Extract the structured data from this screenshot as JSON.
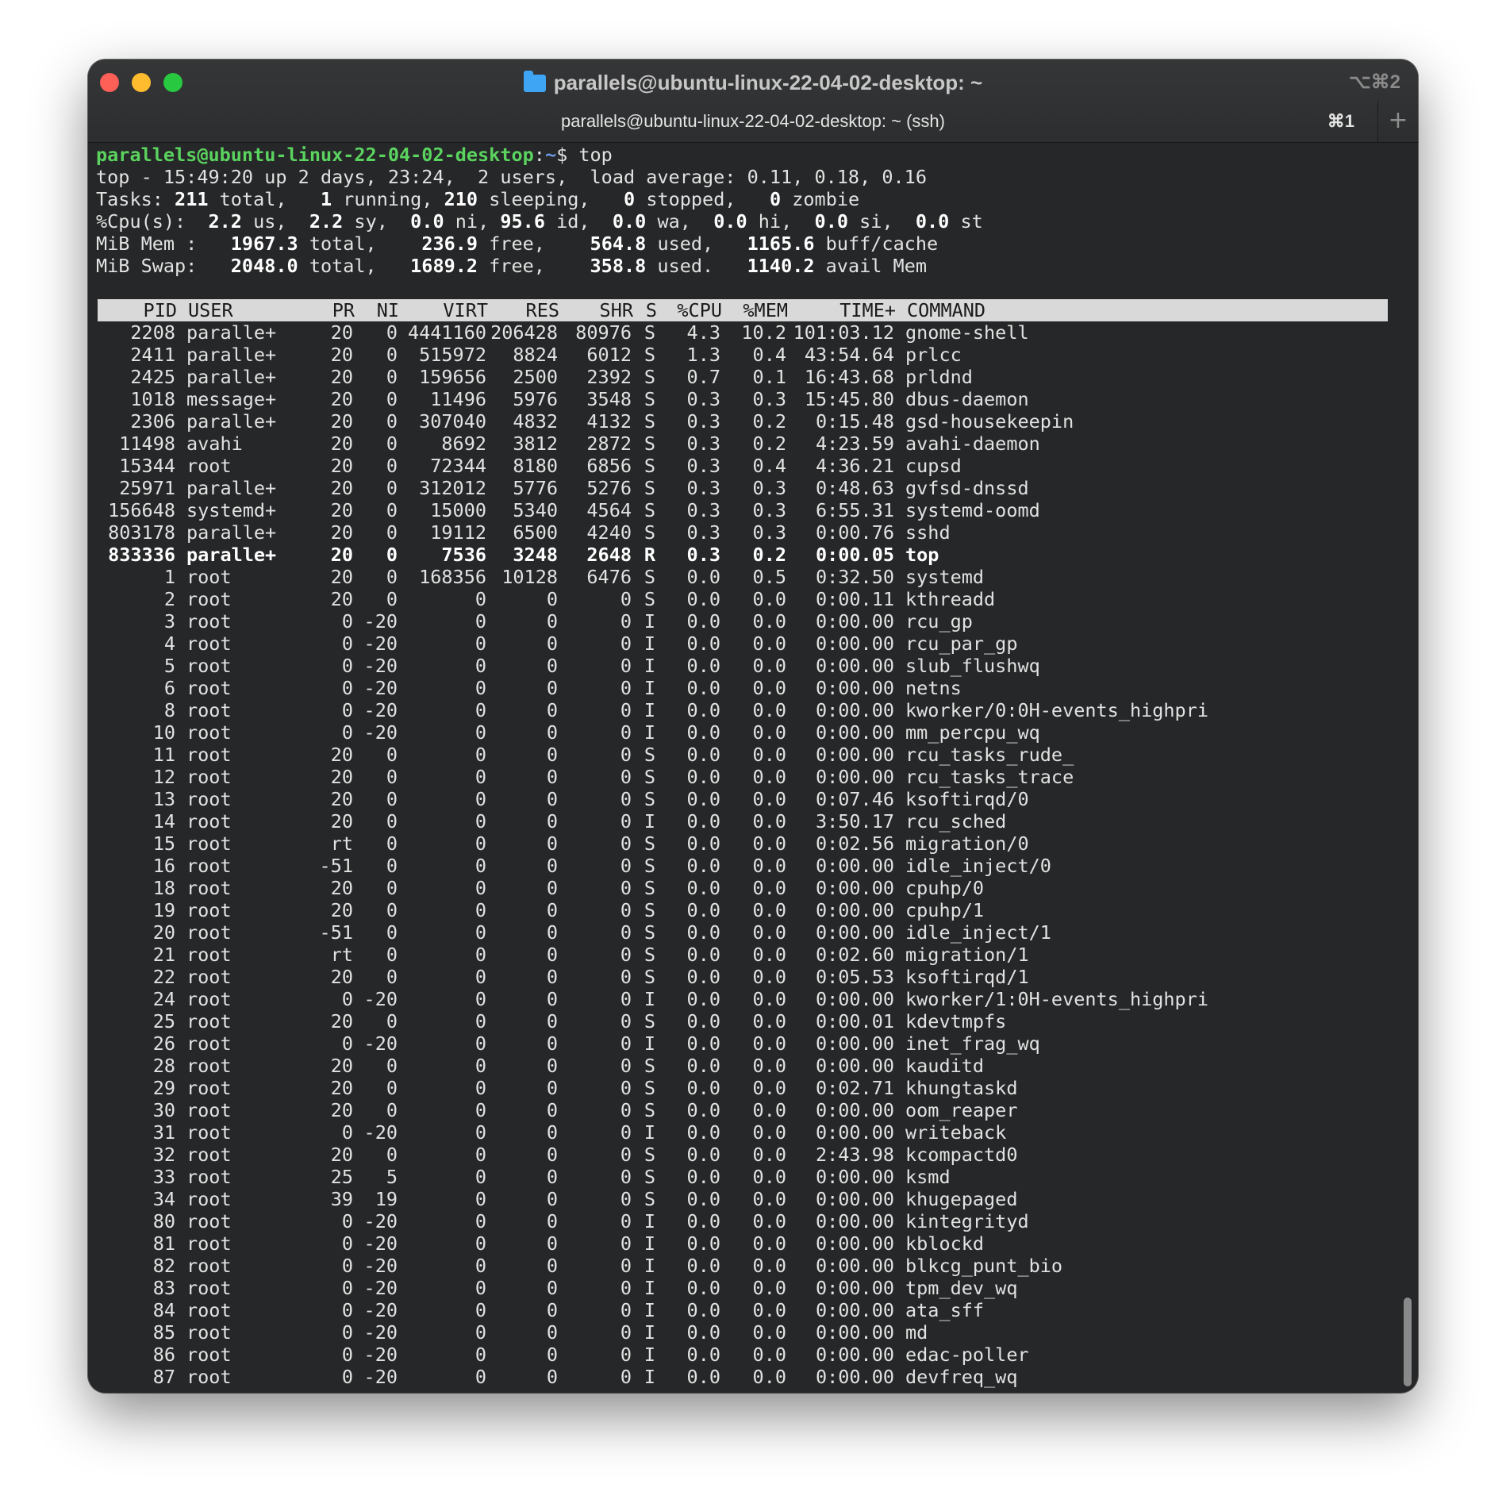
{
  "window": {
    "title": "parallels@ubuntu-linux-22-04-02-desktop: ~",
    "shortcut": "⌥⌘2",
    "icon": "folder-icon"
  },
  "tab": {
    "title": "parallels@ubuntu-linux-22-04-02-desktop: ~ (ssh)",
    "shortcut": "⌘1",
    "new_tab_symbol": "+"
  },
  "colors": {
    "prompt_user": "#5bd35f",
    "prompt_path": "#6f98e6",
    "header_bg": "#d9d9d9",
    "background": "#262728"
  },
  "prompt": {
    "user_host": "parallels@ubuntu-linux-22-04-02-desktop",
    "colon": ":",
    "path": "~",
    "symbol": "$ ",
    "command": "top"
  },
  "summary": {
    "line1": "top - 15:49:20 up 2 days, 23:24,  2 users,  load average: 0.11, 0.18, 0.16",
    "tasks": {
      "label": "Tasks: ",
      "total": "211",
      "total_label": " total,   ",
      "running": "1",
      "running_label": " running, ",
      "sleeping": "210",
      "sleeping_label": " sleeping,   ",
      "stopped": "0",
      "stopped_label": " stopped,   ",
      "zombie": "0",
      "zombie_label": " zombie"
    },
    "cpu": {
      "label": "%Cpu(s):  ",
      "us": "2.2",
      "us_label": " us,  ",
      "sy": "2.2",
      "sy_label": " sy,  ",
      "ni": "0.0",
      "ni_label": " ni, ",
      "id": "95.6",
      "id_label": " id,  ",
      "wa": "0.0",
      "wa_label": " wa,  ",
      "hi": "0.0",
      "hi_label": " hi,  ",
      "si": "0.0",
      "si_label": " si,  ",
      "st": "0.0",
      "st_label": " st"
    },
    "mem": {
      "label": "MiB Mem :   ",
      "total": "1967.3",
      "total_label": " total,    ",
      "free": "236.9",
      "free_label": " free,    ",
      "used": "564.8",
      "used_label": " used,   ",
      "buff": "1165.6",
      "buff_label": " buff/cache"
    },
    "swap": {
      "label": "MiB Swap:   ",
      "total": "2048.0",
      "total_label": " total,   ",
      "free": "1689.2",
      "free_label": " free,    ",
      "used": "358.8",
      "used_label": " used.   ",
      "avail": "1140.2",
      "avail_label": " avail Mem"
    }
  },
  "table": {
    "headers": [
      "PID",
      "USER",
      "PR",
      "NI",
      "VIRT",
      "RES",
      "SHR",
      "S",
      "%CPU",
      "%MEM",
      "TIME+",
      "COMMAND"
    ],
    "rows": [
      [
        "2208",
        "paralle+",
        "20",
        "0",
        "4441160",
        "206428",
        "80976",
        "S",
        "4.3",
        "10.2",
        "101:03.12",
        "gnome-shell"
      ],
      [
        "2411",
        "paralle+",
        "20",
        "0",
        "515972",
        "8824",
        "6012",
        "S",
        "1.3",
        "0.4",
        "43:54.64",
        "prlcc"
      ],
      [
        "2425",
        "paralle+",
        "20",
        "0",
        "159656",
        "2500",
        "2392",
        "S",
        "0.7",
        "0.1",
        "16:43.68",
        "prldnd"
      ],
      [
        "1018",
        "message+",
        "20",
        "0",
        "11496",
        "5976",
        "3548",
        "S",
        "0.3",
        "0.3",
        "15:45.80",
        "dbus-daemon"
      ],
      [
        "2306",
        "paralle+",
        "20",
        "0",
        "307040",
        "4832",
        "4132",
        "S",
        "0.3",
        "0.2",
        "0:15.48",
        "gsd-housekeepin"
      ],
      [
        "11498",
        "avahi",
        "20",
        "0",
        "8692",
        "3812",
        "2872",
        "S",
        "0.3",
        "0.2",
        "4:23.59",
        "avahi-daemon"
      ],
      [
        "15344",
        "root",
        "20",
        "0",
        "72344",
        "8180",
        "6856",
        "S",
        "0.3",
        "0.4",
        "4:36.21",
        "cupsd"
      ],
      [
        "25971",
        "paralle+",
        "20",
        "0",
        "312012",
        "5776",
        "5276",
        "S",
        "0.3",
        "0.3",
        "0:48.63",
        "gvfsd-dnssd"
      ],
      [
        "156648",
        "systemd+",
        "20",
        "0",
        "15000",
        "5340",
        "4564",
        "S",
        "0.3",
        "0.3",
        "6:55.31",
        "systemd-oomd"
      ],
      [
        "803178",
        "paralle+",
        "20",
        "0",
        "19112",
        "6500",
        "4240",
        "S",
        "0.3",
        "0.3",
        "0:00.76",
        "sshd"
      ],
      [
        "833336",
        "paralle+",
        "20",
        "0",
        "7536",
        "3248",
        "2648",
        "R",
        "0.3",
        "0.2",
        "0:00.05",
        "top"
      ],
      [
        "1",
        "root",
        "20",
        "0",
        "168356",
        "10128",
        "6476",
        "S",
        "0.0",
        "0.5",
        "0:32.50",
        "systemd"
      ],
      [
        "2",
        "root",
        "20",
        "0",
        "0",
        "0",
        "0",
        "S",
        "0.0",
        "0.0",
        "0:00.11",
        "kthreadd"
      ],
      [
        "3",
        "root",
        "0",
        "-20",
        "0",
        "0",
        "0",
        "I",
        "0.0",
        "0.0",
        "0:00.00",
        "rcu_gp"
      ],
      [
        "4",
        "root",
        "0",
        "-20",
        "0",
        "0",
        "0",
        "I",
        "0.0",
        "0.0",
        "0:00.00",
        "rcu_par_gp"
      ],
      [
        "5",
        "root",
        "0",
        "-20",
        "0",
        "0",
        "0",
        "I",
        "0.0",
        "0.0",
        "0:00.00",
        "slub_flushwq"
      ],
      [
        "6",
        "root",
        "0",
        "-20",
        "0",
        "0",
        "0",
        "I",
        "0.0",
        "0.0",
        "0:00.00",
        "netns"
      ],
      [
        "8",
        "root",
        "0",
        "-20",
        "0",
        "0",
        "0",
        "I",
        "0.0",
        "0.0",
        "0:00.00",
        "kworker/0:0H-events_highpri"
      ],
      [
        "10",
        "root",
        "0",
        "-20",
        "0",
        "0",
        "0",
        "I",
        "0.0",
        "0.0",
        "0:00.00",
        "mm_percpu_wq"
      ],
      [
        "11",
        "root",
        "20",
        "0",
        "0",
        "0",
        "0",
        "S",
        "0.0",
        "0.0",
        "0:00.00",
        "rcu_tasks_rude_"
      ],
      [
        "12",
        "root",
        "20",
        "0",
        "0",
        "0",
        "0",
        "S",
        "0.0",
        "0.0",
        "0:00.00",
        "rcu_tasks_trace"
      ],
      [
        "13",
        "root",
        "20",
        "0",
        "0",
        "0",
        "0",
        "S",
        "0.0",
        "0.0",
        "0:07.46",
        "ksoftirqd/0"
      ],
      [
        "14",
        "root",
        "20",
        "0",
        "0",
        "0",
        "0",
        "I",
        "0.0",
        "0.0",
        "3:50.17",
        "rcu_sched"
      ],
      [
        "15",
        "root",
        "rt",
        "0",
        "0",
        "0",
        "0",
        "S",
        "0.0",
        "0.0",
        "0:02.56",
        "migration/0"
      ],
      [
        "16",
        "root",
        "-51",
        "0",
        "0",
        "0",
        "0",
        "S",
        "0.0",
        "0.0",
        "0:00.00",
        "idle_inject/0"
      ],
      [
        "18",
        "root",
        "20",
        "0",
        "0",
        "0",
        "0",
        "S",
        "0.0",
        "0.0",
        "0:00.00",
        "cpuhp/0"
      ],
      [
        "19",
        "root",
        "20",
        "0",
        "0",
        "0",
        "0",
        "S",
        "0.0",
        "0.0",
        "0:00.00",
        "cpuhp/1"
      ],
      [
        "20",
        "root",
        "-51",
        "0",
        "0",
        "0",
        "0",
        "S",
        "0.0",
        "0.0",
        "0:00.00",
        "idle_inject/1"
      ],
      [
        "21",
        "root",
        "rt",
        "0",
        "0",
        "0",
        "0",
        "S",
        "0.0",
        "0.0",
        "0:02.60",
        "migration/1"
      ],
      [
        "22",
        "root",
        "20",
        "0",
        "0",
        "0",
        "0",
        "S",
        "0.0",
        "0.0",
        "0:05.53",
        "ksoftirqd/1"
      ],
      [
        "24",
        "root",
        "0",
        "-20",
        "0",
        "0",
        "0",
        "I",
        "0.0",
        "0.0",
        "0:00.00",
        "kworker/1:0H-events_highpri"
      ],
      [
        "25",
        "root",
        "20",
        "0",
        "0",
        "0",
        "0",
        "S",
        "0.0",
        "0.0",
        "0:00.01",
        "kdevtmpfs"
      ],
      [
        "26",
        "root",
        "0",
        "-20",
        "0",
        "0",
        "0",
        "I",
        "0.0",
        "0.0",
        "0:00.00",
        "inet_frag_wq"
      ],
      [
        "28",
        "root",
        "20",
        "0",
        "0",
        "0",
        "0",
        "S",
        "0.0",
        "0.0",
        "0:00.00",
        "kauditd"
      ],
      [
        "29",
        "root",
        "20",
        "0",
        "0",
        "0",
        "0",
        "S",
        "0.0",
        "0.0",
        "0:02.71",
        "khungtaskd"
      ],
      [
        "30",
        "root",
        "20",
        "0",
        "0",
        "0",
        "0",
        "S",
        "0.0",
        "0.0",
        "0:00.00",
        "oom_reaper"
      ],
      [
        "31",
        "root",
        "0",
        "-20",
        "0",
        "0",
        "0",
        "I",
        "0.0",
        "0.0",
        "0:00.00",
        "writeback"
      ],
      [
        "32",
        "root",
        "20",
        "0",
        "0",
        "0",
        "0",
        "S",
        "0.0",
        "0.0",
        "2:43.98",
        "kcompactd0"
      ],
      [
        "33",
        "root",
        "25",
        "5",
        "0",
        "0",
        "0",
        "S",
        "0.0",
        "0.0",
        "0:00.00",
        "ksmd"
      ],
      [
        "34",
        "root",
        "39",
        "19",
        "0",
        "0",
        "0",
        "S",
        "0.0",
        "0.0",
        "0:00.00",
        "khugepaged"
      ],
      [
        "80",
        "root",
        "0",
        "-20",
        "0",
        "0",
        "0",
        "I",
        "0.0",
        "0.0",
        "0:00.00",
        "kintegrityd"
      ],
      [
        "81",
        "root",
        "0",
        "-20",
        "0",
        "0",
        "0",
        "I",
        "0.0",
        "0.0",
        "0:00.00",
        "kblockd"
      ],
      [
        "82",
        "root",
        "0",
        "-20",
        "0",
        "0",
        "0",
        "I",
        "0.0",
        "0.0",
        "0:00.00",
        "blkcg_punt_bio"
      ],
      [
        "83",
        "root",
        "0",
        "-20",
        "0",
        "0",
        "0",
        "I",
        "0.0",
        "0.0",
        "0:00.00",
        "tpm_dev_wq"
      ],
      [
        "84",
        "root",
        "0",
        "-20",
        "0",
        "0",
        "0",
        "I",
        "0.0",
        "0.0",
        "0:00.00",
        "ata_sff"
      ],
      [
        "85",
        "root",
        "0",
        "-20",
        "0",
        "0",
        "0",
        "I",
        "0.0",
        "0.0",
        "0:00.00",
        "md"
      ],
      [
        "86",
        "root",
        "0",
        "-20",
        "0",
        "0",
        "0",
        "I",
        "0.0",
        "0.0",
        "0:00.00",
        "edac-poller"
      ],
      [
        "87",
        "root",
        "0",
        "-20",
        "0",
        "0",
        "0",
        "I",
        "0.0",
        "0.0",
        "0:00.00",
        "devfreq_wq"
      ]
    ],
    "highlight_row_pid": "833336"
  }
}
